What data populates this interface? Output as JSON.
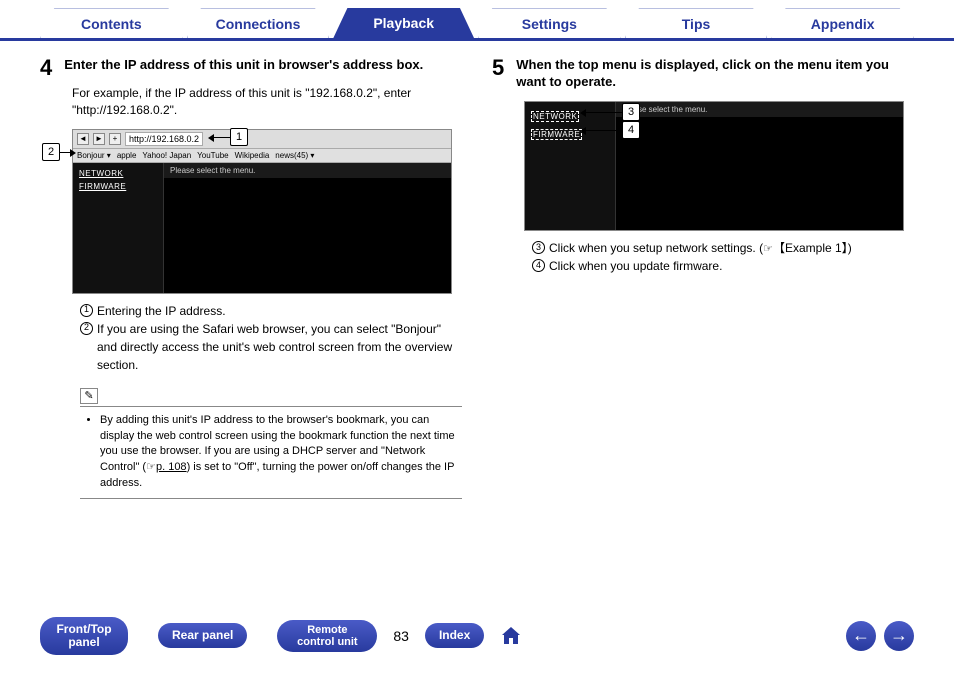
{
  "tabs": {
    "contents": "Contents",
    "connections": "Connections",
    "playback": "Playback",
    "settings": "Settings",
    "tips": "Tips",
    "appendix": "Appendix"
  },
  "step4": {
    "num": "4",
    "title": "Enter the IP address of this unit in browser's address box.",
    "sub": "For example, if the IP address of this unit is \"192.168.0.2\", enter \"http://192.168.0.2\".",
    "callout1": "1",
    "callout2": "2",
    "browser": {
      "addr": "http://192.168.0.2",
      "bookmarks": [
        "Bonjour ▾",
        "apple",
        "Yahoo! Japan",
        "YouTube",
        "Wikipedia",
        "news(45) ▾"
      ],
      "side_network": "NETWORK",
      "side_firmware": "FIRMWARE",
      "main_head": "Please select the menu."
    },
    "legend1": "Entering the IP address.",
    "legend2": "If you are using the Safari web browser, you can select \"Bonjour\" and directly access the unit's web control screen from the overview section.",
    "note": "By adding this unit's IP address to the browser's bookmark, you can display the web control screen using the bookmark function the next time you use the browser. If you are using a DHCP server and \"Network Control\" (",
    "note_link": "p. 108",
    "note_tail": ") is set to \"Off\", turning the power on/off changes the IP address.",
    "hand": "☞"
  },
  "step5": {
    "num": "5",
    "title": "When the top menu is displayed, click on the menu item you want to operate.",
    "callout3": "3",
    "callout4": "4",
    "browser": {
      "side_network": "NETWORK",
      "side_firmware": "FIRMWARE",
      "main_head": "Please select the menu."
    },
    "legend3a": "Click when you setup network settings. (",
    "legend3b": "【Example 1】",
    "legend3c": ")",
    "legend4": "Click when you update firmware.",
    "hand": "☞"
  },
  "bottom": {
    "front": "Front/Top panel",
    "rear": "Rear panel",
    "remote": "Remote control unit",
    "page": "83",
    "index": "Index",
    "prev": "←",
    "next": "→"
  }
}
